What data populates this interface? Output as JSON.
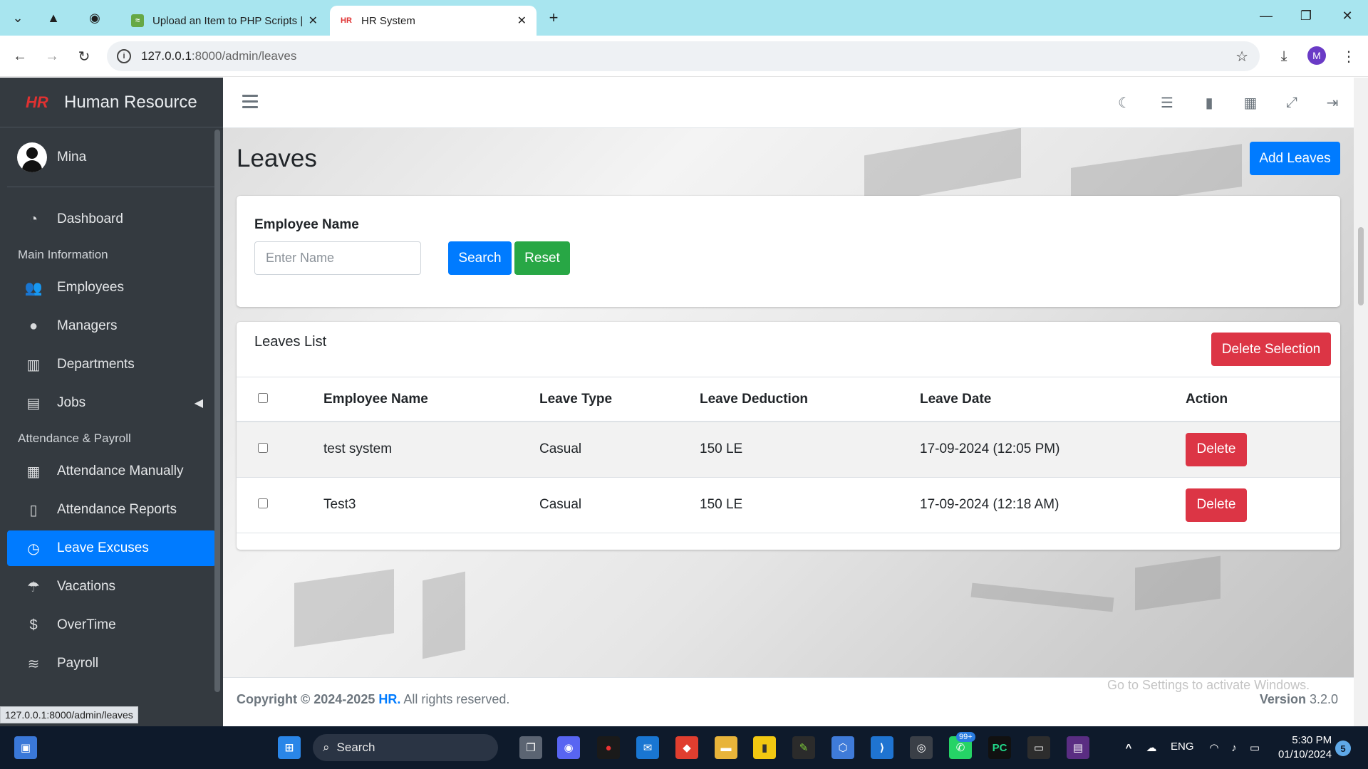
{
  "browser": {
    "tabs": [
      {
        "title": "Upload an Item to PHP Scripts |"
      },
      {
        "title": "HR System"
      }
    ],
    "url_host": "127.0.0.1",
    "url_path": ":8000/admin/leaves",
    "profile_initial": "M",
    "status_url": "127.0.0.1:8000/admin/leaves"
  },
  "sidebar": {
    "brand": "Human Resource",
    "brand_logo": "HR",
    "user_name": "Mina",
    "items": [
      {
        "label": "Dashboard",
        "icon": "tachometer-icon"
      },
      {
        "header": "Main Information"
      },
      {
        "label": "Employees",
        "icon": "users-icon"
      },
      {
        "label": "Managers",
        "icon": "user-icon"
      },
      {
        "label": "Departments",
        "icon": "building-icon"
      },
      {
        "label": "Jobs",
        "icon": "briefcase-icon"
      },
      {
        "header": "Attendance & Payroll"
      },
      {
        "label": "Attendance Manually",
        "icon": "calendar-icon"
      },
      {
        "label": "Attendance Reports",
        "icon": "file-icon"
      },
      {
        "label": "Leave Excuses",
        "icon": "clock-icon"
      },
      {
        "label": "Vacations",
        "icon": "umbrella-beach-icon"
      },
      {
        "label": "OverTime",
        "icon": "dollar-icon"
      },
      {
        "label": "Payroll",
        "icon": "coins-icon"
      }
    ]
  },
  "page": {
    "title": "Leaves",
    "add_button": "Add Leaves",
    "filter": {
      "label": "Employee Name",
      "placeholder": "Enter Name",
      "search_button": "Search",
      "reset_button": "Reset"
    },
    "list": {
      "title": "Leaves List",
      "delete_selection_button": "Delete Selection",
      "columns": [
        "Employee Name",
        "Leave Type",
        "Leave Deduction",
        "Leave Date",
        "Action"
      ],
      "rows": [
        {
          "name": "test system",
          "type": "Casual",
          "deduction": "150 LE",
          "date": "17-09-2024 (12:05 PM)",
          "action": "Delete"
        },
        {
          "name": "Test3",
          "type": "Casual",
          "deduction": "150 LE",
          "date": "17-09-2024 (12:18 AM)",
          "action": "Delete"
        }
      ]
    }
  },
  "footer": {
    "copyright_prefix": "Copyright © 2024-2025",
    "brand": "HR.",
    "rights": "All rights reserved.",
    "version_label": "Version",
    "version": "3.2.0",
    "activate_windows": "Go to Settings to activate Windows."
  },
  "taskbar": {
    "search": "Search",
    "language": "ENG",
    "time": "5:30 PM",
    "date": "01/10/2024",
    "whatsapp_badge": "99+",
    "notification_count": "5"
  },
  "colors": {
    "primary": "#007bff",
    "success": "#28a745",
    "danger": "#dc3545",
    "sidebar": "#343a40",
    "tabbar": "#a8e5ef"
  }
}
